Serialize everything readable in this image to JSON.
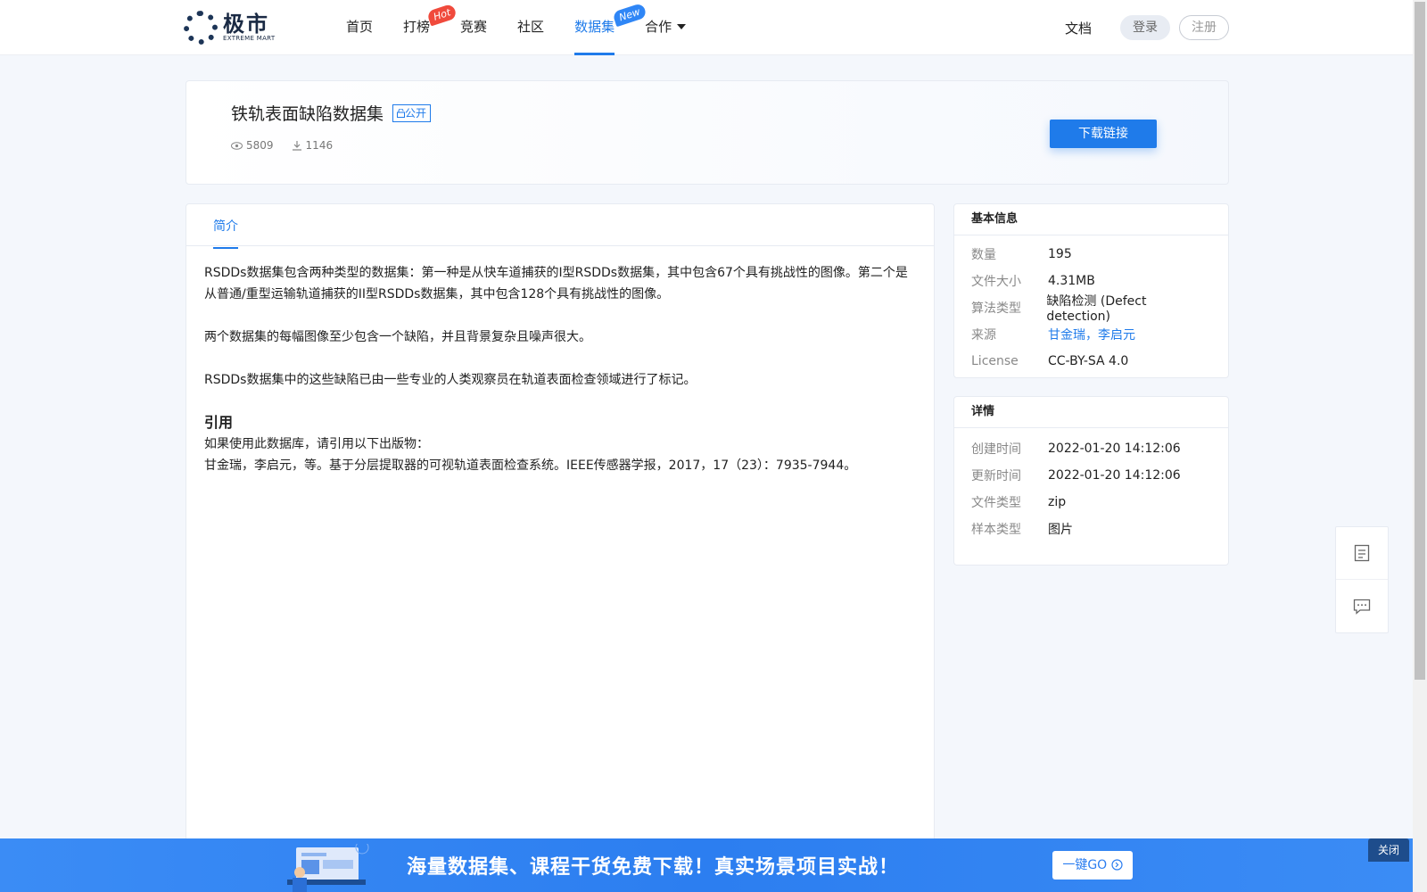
{
  "brand": {
    "name_cn": "极市",
    "name_en": "EXTREME MART"
  },
  "nav": {
    "items": [
      {
        "label": "首页"
      },
      {
        "label": "打榜",
        "badge": "Hot"
      },
      {
        "label": "竞赛"
      },
      {
        "label": "社区"
      },
      {
        "label": "数据集",
        "badge": "New",
        "active": true
      },
      {
        "label": "合作",
        "dropdown": true
      }
    ],
    "docs": "文档",
    "login": "登录",
    "register": "注册"
  },
  "dataset": {
    "title": "铁轨表面缺陷数据集",
    "visibility": "公开",
    "views": "5809",
    "downloads": "1146",
    "download_button": "下载链接"
  },
  "tabs": {
    "intro": "简介"
  },
  "intro": {
    "p1": "RSDDs数据集包含两种类型的数据集：第一种是从快车道捕获的I型RSDDs数据集，其中包含67个具有挑战性的图像。第二个是从普通/重型运输轨道捕获的II型RSDDs数据集，其中包含128个具有挑战性的图像。",
    "p2": "两个数据集的每幅图像至少包含一个缺陷，并且背景复杂且噪声很大。",
    "p3": "RSDDs数据集中的这些缺陷已由一些专业的人类观察员在轨道表面检查领域进行了标记。",
    "cite_heading": "引用",
    "cite_intro": "如果使用此数据库，请引用以下出版物：",
    "cite_ref": "甘金瑞，李启元，等。基于分层提取器的可视轨道表面检查系统。IEEE传感器学报，2017，17（23）：7935-7944。"
  },
  "basic_info": {
    "heading": "基本信息",
    "rows": [
      {
        "k": "数量",
        "v": "195"
      },
      {
        "k": "文件大小",
        "v": "4.31MB"
      },
      {
        "k": "算法类型",
        "v": "缺陷检测 (Defect detection)"
      },
      {
        "k": "来源",
        "v": "甘金瑞，李启元"
      },
      {
        "k": "License",
        "v": "CC-BY-SA 4.0"
      }
    ]
  },
  "details": {
    "heading": "详情",
    "rows": [
      {
        "k": "创建时间",
        "v": "2022-01-20 14:12:06"
      },
      {
        "k": "更新时间",
        "v": "2022-01-20 14:12:06"
      },
      {
        "k": "文件类型",
        "v": "zip"
      },
      {
        "k": "样本类型",
        "v": "图片"
      }
    ]
  },
  "banner": {
    "text": "海量数据集、课程干货免费下载！真实场景项目实战！",
    "go": "一键GO",
    "close": "关闭"
  },
  "colors": {
    "accent": "#1f7bea",
    "hot": "#f04a3c",
    "banner": "#2c7ef0"
  },
  "icons": [
    "eye-icon",
    "download-icon",
    "caret-down-icon",
    "document-icon",
    "chat-icon",
    "arrow-circle-icon"
  ]
}
